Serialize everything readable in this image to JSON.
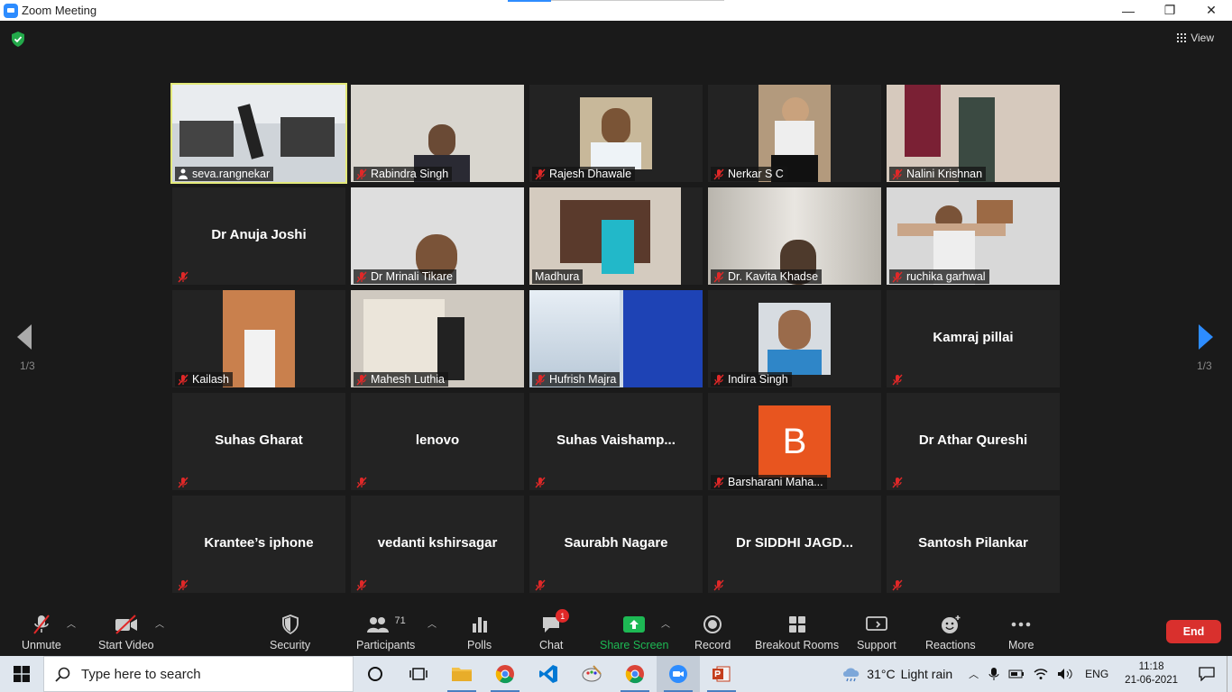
{
  "window": {
    "title": "Zoom Meeting",
    "min": "—",
    "restore": "❐",
    "close": "✕"
  },
  "view_label": "View",
  "pagination": {
    "left": "1/3",
    "right": "1/3"
  },
  "tiles": [
    {
      "name": "seva.rangnekar",
      "video": true,
      "active": true,
      "muted": false
    },
    {
      "name": "Rabindra Singh",
      "video": true,
      "muted": true
    },
    {
      "name": "Rajesh Dhawale",
      "video": true,
      "muted": true
    },
    {
      "name": "Nerkar S C",
      "video": true,
      "muted": true
    },
    {
      "name": "Nalini Krishnan",
      "video": true,
      "muted": true
    },
    {
      "name": "Dr Anuja Joshi",
      "video": false,
      "muted": true
    },
    {
      "name": "Dr Mrinali Tikare",
      "video": true,
      "muted": true
    },
    {
      "name": "Madhura",
      "video": true,
      "muted": false
    },
    {
      "name": "Dr. Kavita Khadse",
      "video": true,
      "muted": true
    },
    {
      "name": "ruchika garhwal",
      "video": true,
      "muted": true
    },
    {
      "name": "Kailash",
      "video": true,
      "muted": true
    },
    {
      "name": "Mahesh Luthia",
      "video": true,
      "muted": true
    },
    {
      "name": "Hufrish Majra",
      "video": true,
      "muted": true
    },
    {
      "name": "Indira Singh",
      "video": true,
      "muted": true
    },
    {
      "name": "Kamraj pillai",
      "video": false,
      "muted": true
    },
    {
      "name": "Suhas Gharat",
      "video": false,
      "muted": true
    },
    {
      "name": "lenovo",
      "video": false,
      "muted": true
    },
    {
      "name": "Suhas  Vaishamp...",
      "video": false,
      "muted": true
    },
    {
      "name": "Barsharani Maha...",
      "video": false,
      "avatar": "B",
      "muted": true
    },
    {
      "name": "Dr Athar Qureshi",
      "video": false,
      "muted": true
    },
    {
      "name": "Krantee’s iphone",
      "video": false,
      "muted": true
    },
    {
      "name": "vedanti kshirsagar",
      "video": false,
      "muted": true
    },
    {
      "name": "Saurabh Nagare",
      "video": false,
      "muted": true
    },
    {
      "name": "Dr SIDDHI JAGD...",
      "video": false,
      "muted": true
    },
    {
      "name": "Santosh Pilankar",
      "video": false,
      "muted": true
    }
  ],
  "toolbar": {
    "unmute": "Unmute",
    "start_video": "Start Video",
    "security": "Security",
    "participants": "Participants",
    "participants_count": "71",
    "polls": "Polls",
    "chat": "Chat",
    "chat_badge": "1",
    "share_screen": "Share Screen",
    "record": "Record",
    "breakout_rooms": "Breakout Rooms",
    "support": "Support",
    "reactions": "Reactions",
    "more": "More",
    "end": "End"
  },
  "taskbar": {
    "search_placeholder": "Type here to search",
    "temperature": "31°C",
    "weather": "Light rain",
    "language": "ENG",
    "time": "11:18",
    "date": "21-06-2021"
  },
  "colors": {
    "active_speaker": "#e3e97a",
    "end_button": "#d9302d",
    "share_green": "#1db954",
    "avatar_orange": "#e8551f"
  }
}
